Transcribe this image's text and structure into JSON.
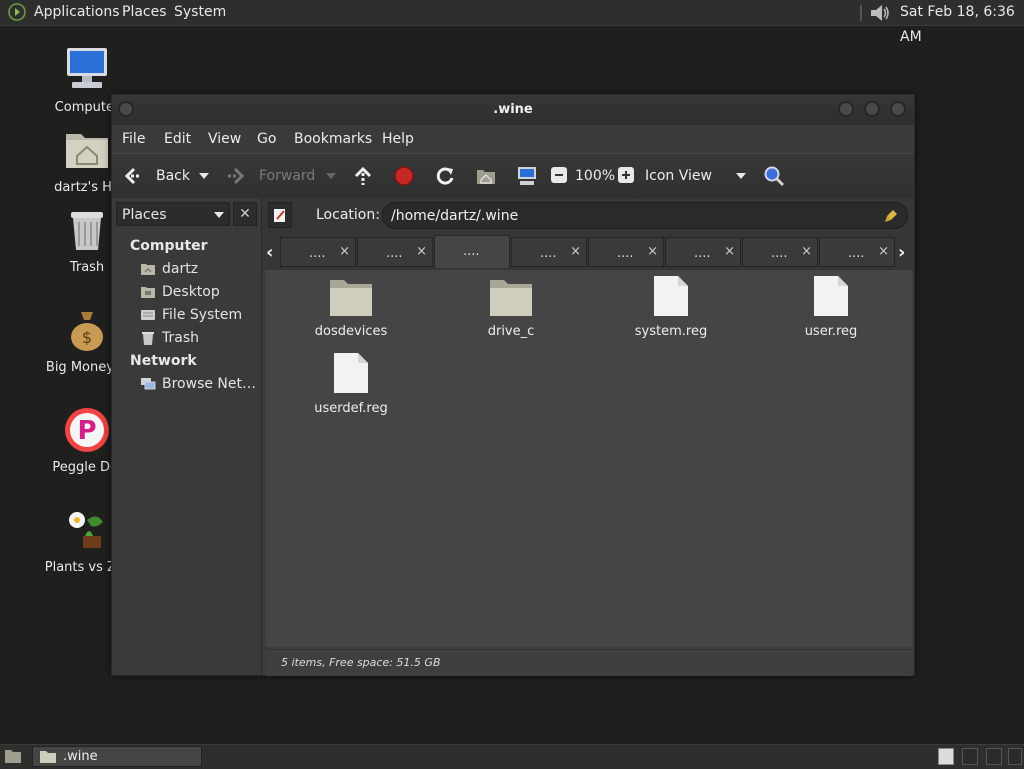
{
  "top_panel": {
    "menus": [
      "Applications",
      "Places",
      "System"
    ],
    "clock": "Sat Feb 18,  6:36 AM"
  },
  "desktop": {
    "icons": [
      {
        "label": "Computer",
        "icon": "computer-icon"
      },
      {
        "label": "dartz's Ho",
        "icon": "home-folder-icon"
      },
      {
        "label": "Trash",
        "icon": "trash-icon"
      },
      {
        "label": "Big Money D",
        "icon": "money-bag-icon"
      },
      {
        "label": "Peggle Del",
        "icon": "peggle-icon"
      },
      {
        "label": "Plants vs Zor",
        "icon": "plants-icon"
      }
    ]
  },
  "window": {
    "title": ".wine",
    "menu": [
      "File",
      "Edit",
      "View",
      "Go",
      "Bookmarks",
      "Help"
    ],
    "toolbar": {
      "back": "Back",
      "forward": "Forward",
      "zoom": "100%",
      "view_mode": "Icon View"
    },
    "sidebar": {
      "selector": "Places",
      "close": "✕",
      "sections": [
        {
          "heading": "Computer",
          "items": [
            "dartz",
            "Desktop",
            "File System",
            "Trash"
          ]
        },
        {
          "heading": "Network",
          "items": [
            "Browse Net…"
          ]
        }
      ]
    },
    "location": {
      "label": "Location:",
      "value": "/home/dartz/.wine"
    },
    "tabs": [
      "....",
      "....",
      "....",
      "....",
      "....",
      "....",
      "....",
      "...."
    ],
    "tab_close": "×",
    "files": [
      {
        "name": "dosdevices",
        "type": "folder"
      },
      {
        "name": "drive_c",
        "type": "folder"
      },
      {
        "name": "system.reg",
        "type": "file"
      },
      {
        "name": "user.reg",
        "type": "file"
      },
      {
        "name": "userdef.reg",
        "type": "file"
      }
    ],
    "status": "5 items, Free space: 51.5 GB"
  },
  "taskbar": {
    "task_label": ".wine"
  },
  "colors": {
    "desktop_bg": "#1f201e",
    "panel_bg": "#2e2f2d",
    "window_bg": "#3c3c3c",
    "content_bg": "#454545",
    "stop_red": "#c62828"
  }
}
